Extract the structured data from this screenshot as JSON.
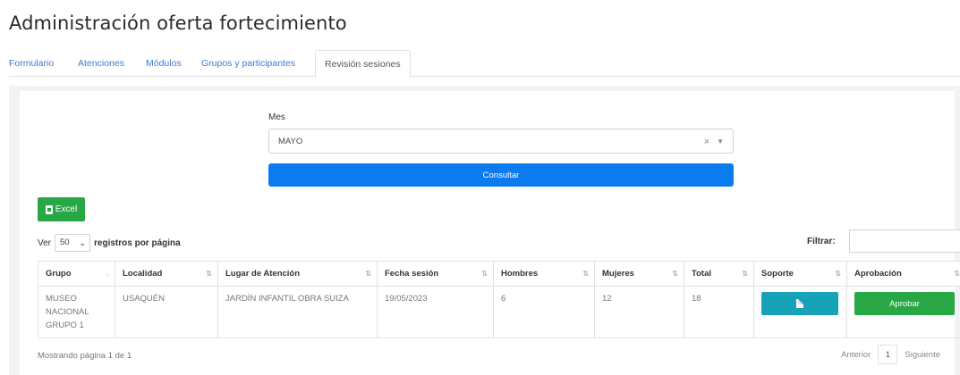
{
  "page": {
    "title": "Administración oferta fortecimiento"
  },
  "tabs": [
    {
      "label": "Formulario"
    },
    {
      "label": "Atenciones"
    },
    {
      "label": "Módulos"
    },
    {
      "label": "Grupos y participantes"
    },
    {
      "label": "Revisión sesiones",
      "active": true
    }
  ],
  "filters": {
    "mes_label": "Mes",
    "mes_value": "MAYO",
    "clear_glyph": "×",
    "consultar_label": "Consultar"
  },
  "toolbar": {
    "excel_label": "Excel",
    "ver_label": "Ver",
    "per_page_value": "50",
    "registros_label": "registros por página",
    "filtrar_label": "Filtrar:"
  },
  "table": {
    "headers": [
      "Grupo",
      "Localidad",
      "Lugar de Atención",
      "Fecha sesión",
      "Hombres",
      "Mujeres",
      "Total",
      "Soporte",
      "Aprobación"
    ],
    "rows": [
      {
        "grupo": "MUSEO NACIONAL GRUPO 1",
        "localidad": "USAQUÉN",
        "lugar": "JARDÍN INFANTIL OBRA SUIZA",
        "fecha": "19/05/2023",
        "hombres": "6",
        "mujeres": "12",
        "total": "18",
        "aprobar_label": "Aprobar"
      }
    ]
  },
  "footer": {
    "info": "Mostrando página 1 de 1",
    "prev_label": "Anterior",
    "page_number": "1",
    "next_label": "Siguiente"
  },
  "colors": {
    "primary": "#0b7bf0",
    "success": "#28a745",
    "info": "#17a2b8",
    "link": "#3a7bd5"
  }
}
